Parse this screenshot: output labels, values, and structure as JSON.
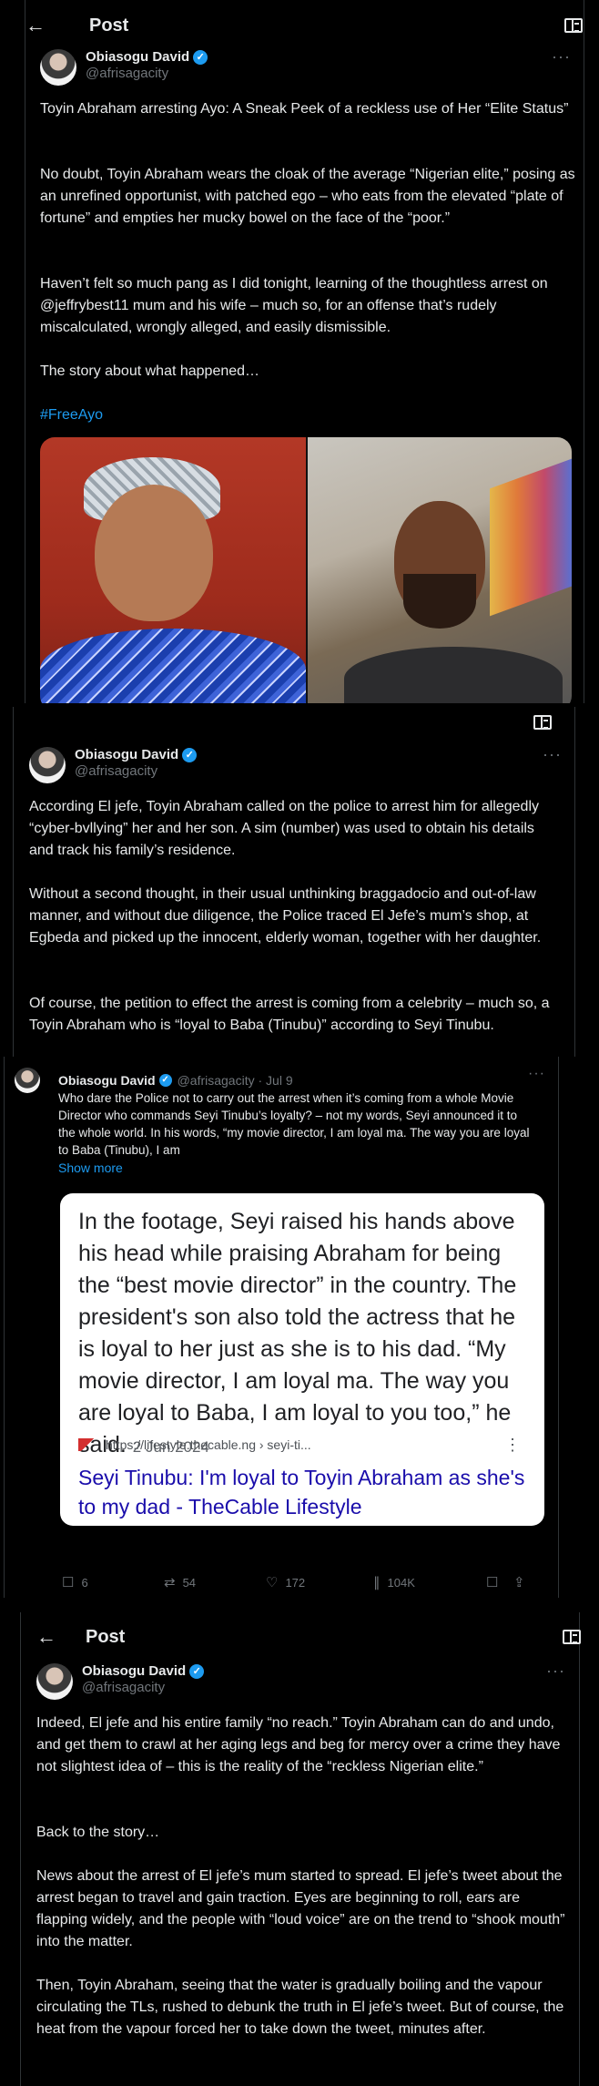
{
  "header": {
    "title": "Post"
  },
  "author": {
    "name": "Obiasogu David",
    "handle": "@afrisagacity",
    "verified_mark": "✓"
  },
  "section1": {
    "paragraphs": [
      "Toyin Abraham arresting Ayo: A Sneak Peek of a reckless use of Her “Elite Status”",
      "No doubt, Toyin Abraham wears the cloak of the average “Nigerian elite,” posing as an unrefined opportunist, with patched ego – who eats from the elevated “plate of fortune” and empties her mucky bowel on the face of the “poor.”",
      "Haven’t felt so much pang as I did tonight, learning of the thoughtless arrest on @jeffrybest11 mum and his wife – much so, for an offense that’s rudely miscalculated, wrongly alleged, and easily dismissible.",
      "The story about what happened…"
    ],
    "hashtag": "#FreeAyo"
  },
  "section2": {
    "paragraphs": [
      "According El jefe, Toyin Abraham called on the police to arrest him for allegedly “cyber-bvllying” her and her son. A sim (number) was used to obtain his details and track his family’s residence.",
      "Without a second thought, in their usual unthinking braggadocio and out-of-law manner, and without due diligence, the Police traced El Jefe’s mum’s shop, at Egbeda and picked up the innocent, elderly woman, together with her daughter.",
      "Of course, the petition to effect the arrest is coming from a celebrity – much so, a Toyin Abraham who is “loyal to Baba (Tinubu)” according to Seyi Tinubu."
    ]
  },
  "section3": {
    "meta": "@afrisagacity · Jul 9",
    "text": "Who dare the Police not to carry out the arrest when it’s coming from a whole Movie Director who commands Seyi Tinubu’s loyalty? – not my words, Seyi announced it to the whole world. In his words, “my movie director, I am loyal ma. The way you are loyal to Baba (Tinubu), I am",
    "show_more": "Show more",
    "card": {
      "snippet": "In the footage, Seyi raised his hands above his head while praising Abraham for being the “best movie director” in the country. The president's son also told the actress that he is loyal to her just as she is to his dad. “My movie director, I am loyal ma. The way you are loyal to Baba, I am loyal to you too,” he said.",
      "date": "2 Jun 2024",
      "source": "https://lifestyle.thecable.ng › seyi-ti...",
      "link": "Seyi Tinubu: I'm loyal to Toyin Abraham as she's to my dad - TheCable Lifestyle"
    },
    "actions": {
      "replies": "6",
      "reposts": "54",
      "likes": "172",
      "views": "104K"
    }
  },
  "section4": {
    "paragraphs": [
      "Indeed, El jefe and his entire family “no reach.” Toyin Abraham can do and undo, and get them to crawl at her aging legs and beg for mercy over a crime they have not slightest idea of – this is the reality of the “reckless Nigerian elite.”",
      "Back to the story…",
      "News about the arrest of El jefe’s mum started to spread. El jefe’s tweet about the arrest began to travel and gain traction. Eyes are beginning to roll, ears are flapping widely, and the people with “loud voice” are on the trend to “shook mouth” into the matter.",
      "Then, Toyin Abraham, seeing that the water is gradually boiling and the vapour circulating the TLs, rushed to debunk the truth in El jefe’s tweet. But of course, the heat from the vapour forced her to take down the tweet, minutes after."
    ]
  },
  "icons": {
    "back": "←",
    "more": "···",
    "reply": "☐",
    "repost": "⇄",
    "like": "♡",
    "views": "∥",
    "bookmark": "☐",
    "share": "⇪"
  }
}
